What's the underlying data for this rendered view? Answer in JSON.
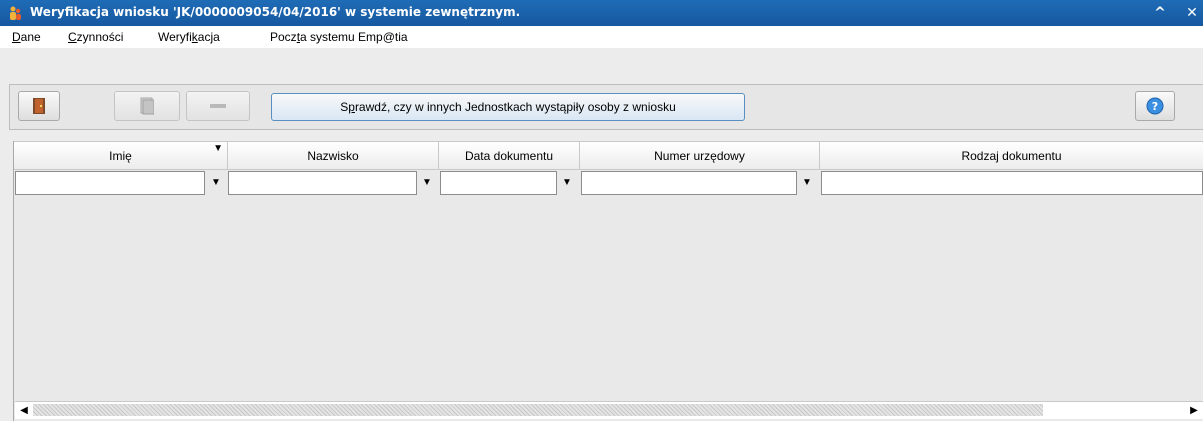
{
  "window": {
    "title": "Weryfikacja wniosku 'JK/0000009054/04/2016' w systemie zewnętrznym.",
    "collapse_glyph": "^",
    "close_glyph": "✕"
  },
  "menu": {
    "items": [
      {
        "pre": "",
        "u": "D",
        "post": "ane"
      },
      {
        "pre": "",
        "u": "C",
        "post": "zynności"
      },
      {
        "pre": "Weryfi",
        "u": "k",
        "post": "acja"
      },
      {
        "pre": "Pocz",
        "u": "t",
        "post": "a systemu Emp@tia"
      }
    ]
  },
  "toolbar": {
    "exit_icon": "exit-door-icon",
    "copy_icon": "document-icon",
    "remove_icon": "minus-icon",
    "check_button": {
      "pre": "S",
      "u": "p",
      "post": "rawdź, czy w innych Jednostkach wystąpiły osoby z wniosku"
    },
    "help_icon": "help-icon"
  },
  "grid": {
    "columns": [
      {
        "label": "Imię"
      },
      {
        "label": "Nazwisko"
      },
      {
        "label": "Data dokumentu"
      },
      {
        "label": "Numer urzędowy"
      },
      {
        "label": "Rodzaj dokumentu"
      }
    ],
    "sorted_column": "Imię",
    "sort_glyph": "▼",
    "dropdown_glyph": "▼",
    "filters": [
      "",
      "",
      "",
      "",
      ""
    ]
  },
  "scrollbar": {
    "left_glyph": "◀",
    "right_glyph": "▶"
  },
  "colors": {
    "titlebar": "#1f6cb6",
    "accent": "#5a8fc4"
  }
}
